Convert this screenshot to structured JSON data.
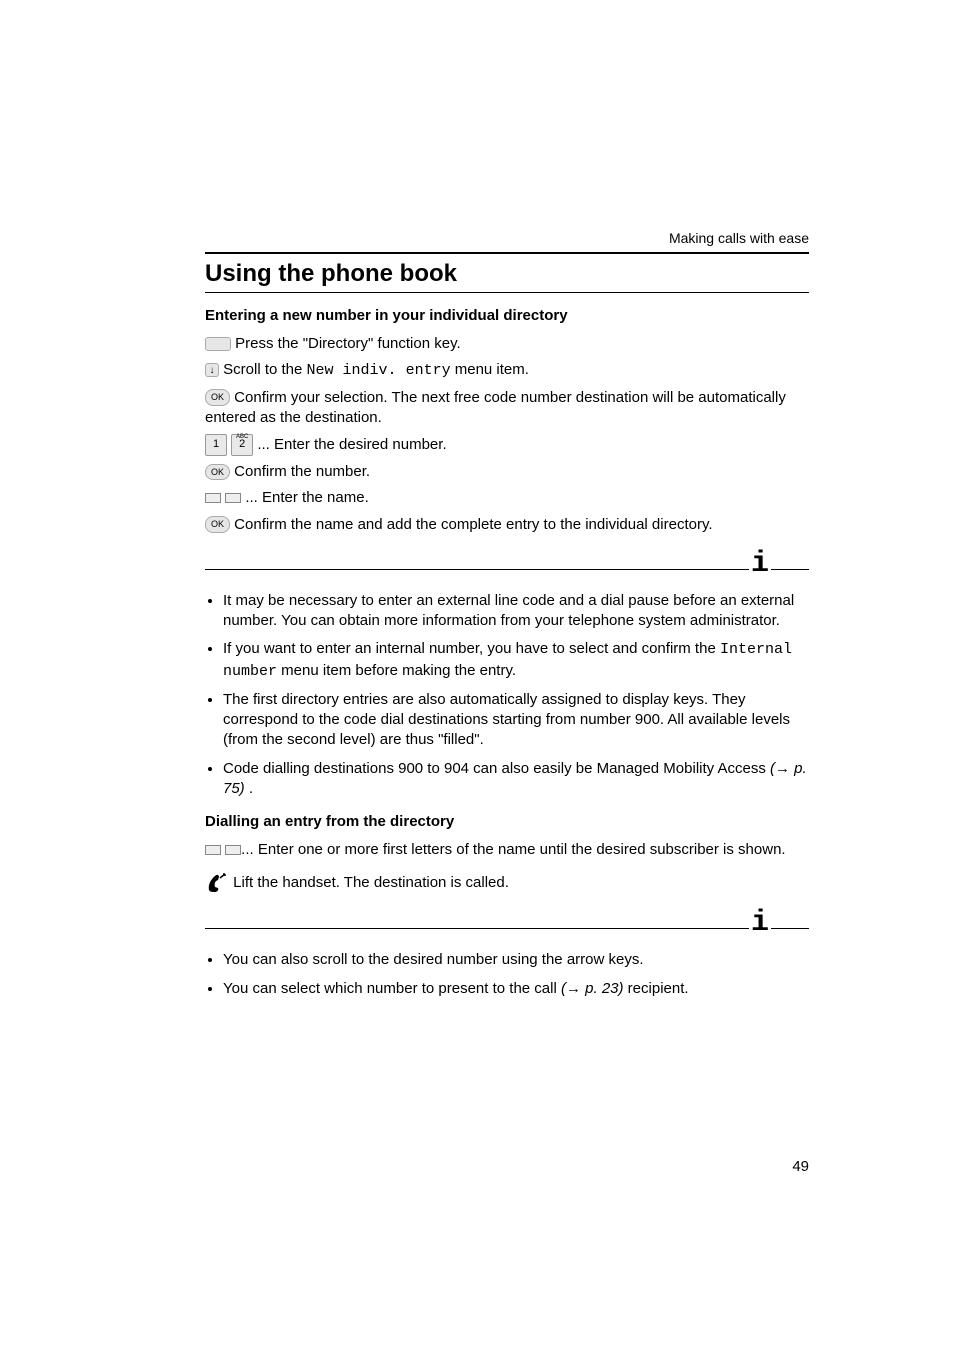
{
  "running_header": "Making calls with ease",
  "title": "Using the phone book",
  "section1": {
    "heading": "Entering a new number in your individual directory",
    "step1": " Press the \"Directory\" function key.",
    "step2a": " Scroll to the ",
    "step2_mono": "New indiv. entry",
    "step2b": " menu item.",
    "step3": " Confirm your selection. The next free code number destination will be automatically entered as the destination.",
    "step4": " ...   Enter the desired number.",
    "step5": "  Confirm the number.",
    "step6": " ... Enter the name.",
    "step7": " Confirm the name and add the complete entry to the individual directory."
  },
  "notes1": {
    "b1": "It may be necessary to enter an external line code and a dial pause before an external number. You can obtain more information from your telephone system administrator.",
    "b2a": "If you want to enter an internal number, you have to select and confirm the ",
    "b2_mono": "Internal number",
    "b2b": " menu item before making the entry.",
    "b3": "The first directory entries are also automatically assigned to display keys. They correspond to the code dial destinations starting from number 900. All available levels (from the second level) are thus \"filled\".",
    "b4a": "Code dialling destinations 900 to 904 can also easily be Managed Mobility Access ",
    "b4_ref": "(→ p. 75)",
    "b4b": " ."
  },
  "section2": {
    "heading": "Dialling an entry from the directory",
    "step1": "...  Enter one or more first letters of the name until the desired subscriber is shown.",
    "step2": "  Lift the handset. The destination is called."
  },
  "notes2": {
    "b1": "You can also scroll to the desired number using the arrow keys.",
    "b2a": "You can select which number to present to the call  ",
    "b2_ref": "(→ p. 23)",
    "b2b": " recipient."
  },
  "page_number": "49"
}
